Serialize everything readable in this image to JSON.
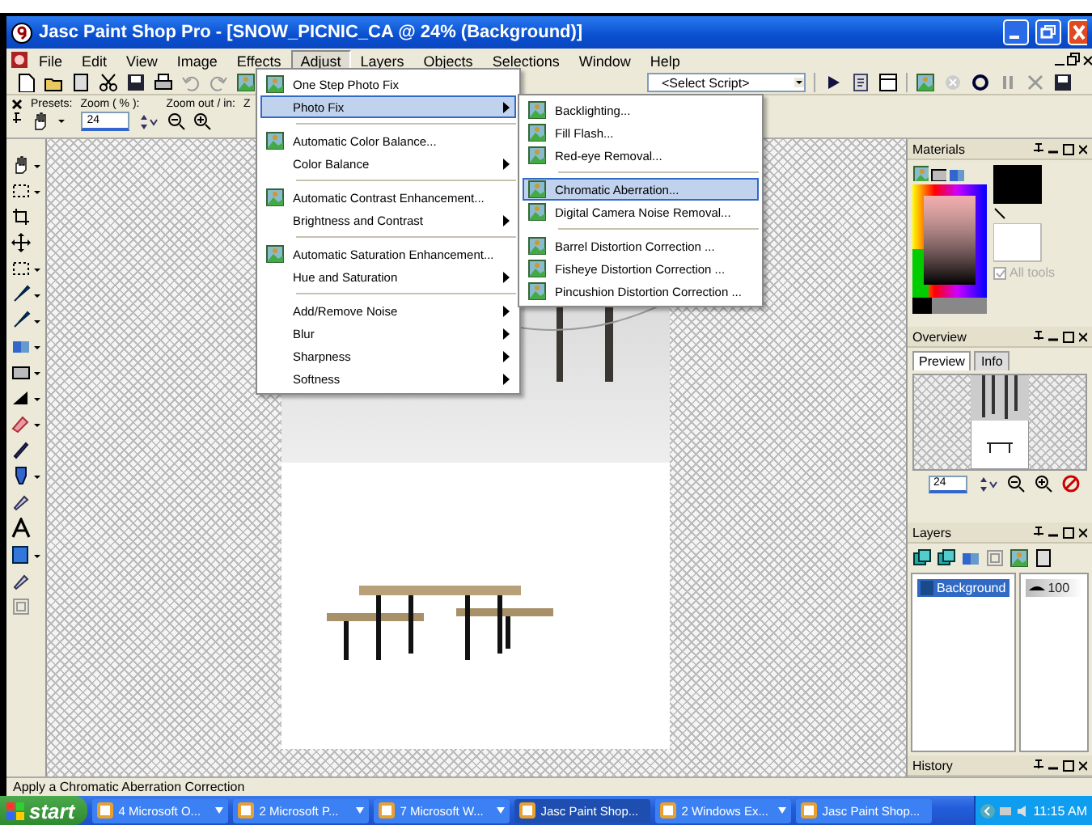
{
  "window": {
    "title": "Jasc Paint Shop Pro - [SNOW_PICNIC_CA @  24% (Background)]"
  },
  "menu_bar": [
    {
      "label": "File",
      "selected": false
    },
    {
      "label": "Edit",
      "selected": false
    },
    {
      "label": "View",
      "selected": false
    },
    {
      "label": "Image",
      "selected": false
    },
    {
      "label": "Effects",
      "selected": false
    },
    {
      "label": "Adjust",
      "selected": true
    },
    {
      "label": "Layers",
      "selected": false
    },
    {
      "label": "Objects",
      "selected": false
    },
    {
      "label": "Selections",
      "selected": false
    },
    {
      "label": "Window",
      "selected": false
    },
    {
      "label": "Help",
      "selected": false
    }
  ],
  "toolbar": {
    "script_select": "<Select Script>"
  },
  "tool_options": {
    "presets_label": "Presets:",
    "zoom_label": "Zoom ( % ):",
    "zoom_value": "24",
    "zoom_buttons_label": "Zoom out / in:",
    "cut_label": "Z"
  },
  "adjust_menu": [
    {
      "kind": "icon_item",
      "label": "One Step Photo Fix",
      "submenu": false,
      "selected": false
    },
    {
      "kind": "item",
      "label": "Photo Fix",
      "submenu": true,
      "selected": true
    },
    {
      "kind": "separator"
    },
    {
      "kind": "icon_item",
      "label": "Automatic Color Balance...",
      "submenu": false,
      "selected": false
    },
    {
      "kind": "item",
      "label": "Color Balance",
      "submenu": true,
      "selected": false
    },
    {
      "kind": "separator"
    },
    {
      "kind": "icon_item",
      "label": "Automatic Contrast Enhancement...",
      "submenu": false,
      "selected": false
    },
    {
      "kind": "item",
      "label": "Brightness and Contrast",
      "submenu": true,
      "selected": false
    },
    {
      "kind": "separator"
    },
    {
      "kind": "icon_item",
      "label": "Automatic Saturation Enhancement...",
      "submenu": false,
      "selected": false
    },
    {
      "kind": "item",
      "label": "Hue and Saturation",
      "submenu": true,
      "selected": false
    },
    {
      "kind": "separator"
    },
    {
      "kind": "item",
      "label": "Add/Remove Noise",
      "submenu": true,
      "selected": false
    },
    {
      "kind": "item",
      "label": "Blur",
      "submenu": true,
      "selected": false
    },
    {
      "kind": "item",
      "label": "Sharpness",
      "submenu": true,
      "selected": false
    },
    {
      "kind": "item",
      "label": "Softness",
      "submenu": true,
      "selected": false
    }
  ],
  "photo_fix_submenu": [
    {
      "kind": "icon_item",
      "label": "Backlighting...",
      "submenu": false,
      "selected": false
    },
    {
      "kind": "icon_item",
      "label": "Fill Flash...",
      "submenu": false,
      "selected": false
    },
    {
      "kind": "icon_item",
      "label": "Red-eye Removal...",
      "submenu": false,
      "selected": false
    },
    {
      "kind": "separator"
    },
    {
      "kind": "icon_item",
      "label": "Chromatic Aberration...",
      "submenu": false,
      "selected": true
    },
    {
      "kind": "icon_item",
      "label": "Digital Camera Noise Removal...",
      "submenu": false,
      "selected": false
    },
    {
      "kind": "separator"
    },
    {
      "kind": "icon_item",
      "label": "Barrel Distortion Correction ...",
      "submenu": false,
      "selected": false
    },
    {
      "kind": "icon_item",
      "label": "Fisheye Distortion Correction ...",
      "submenu": false,
      "selected": false
    },
    {
      "kind": "icon_item",
      "label": "Pincushion Distortion Correction ...",
      "submenu": false,
      "selected": false
    }
  ],
  "panels": {
    "materials": {
      "title": "Materials",
      "all_tools": {
        "label": "All tools",
        "checked": true,
        "disabled": true
      }
    },
    "overview": {
      "title": "Overview",
      "tabs": [
        {
          "label": "Preview",
          "selected": true
        },
        {
          "label": "Info",
          "selected": false
        }
      ],
      "zoom_value": "24"
    },
    "layers": {
      "title": "Layers",
      "layers": [
        {
          "name": "Background",
          "selected": true,
          "opacity": "100"
        }
      ]
    },
    "history": {
      "title": "History"
    }
  },
  "status_bar": "Apply a Chromatic Aberration Correction",
  "taskbar": {
    "start": "start",
    "buttons": [
      {
        "label": "4 Microsoft O...",
        "selected": false,
        "grouped": true
      },
      {
        "label": "2 Microsoft P...",
        "selected": false,
        "grouped": true
      },
      {
        "label": "7 Microsoft W...",
        "selected": false,
        "grouped": true
      },
      {
        "label": "Jasc Paint Shop...",
        "selected": true,
        "grouped": false
      },
      {
        "label": "2 Windows Ex...",
        "selected": false,
        "grouped": true
      },
      {
        "label": "Jasc Paint Shop...",
        "selected": false,
        "grouped": false
      }
    ],
    "clock": "11:15 AM"
  }
}
